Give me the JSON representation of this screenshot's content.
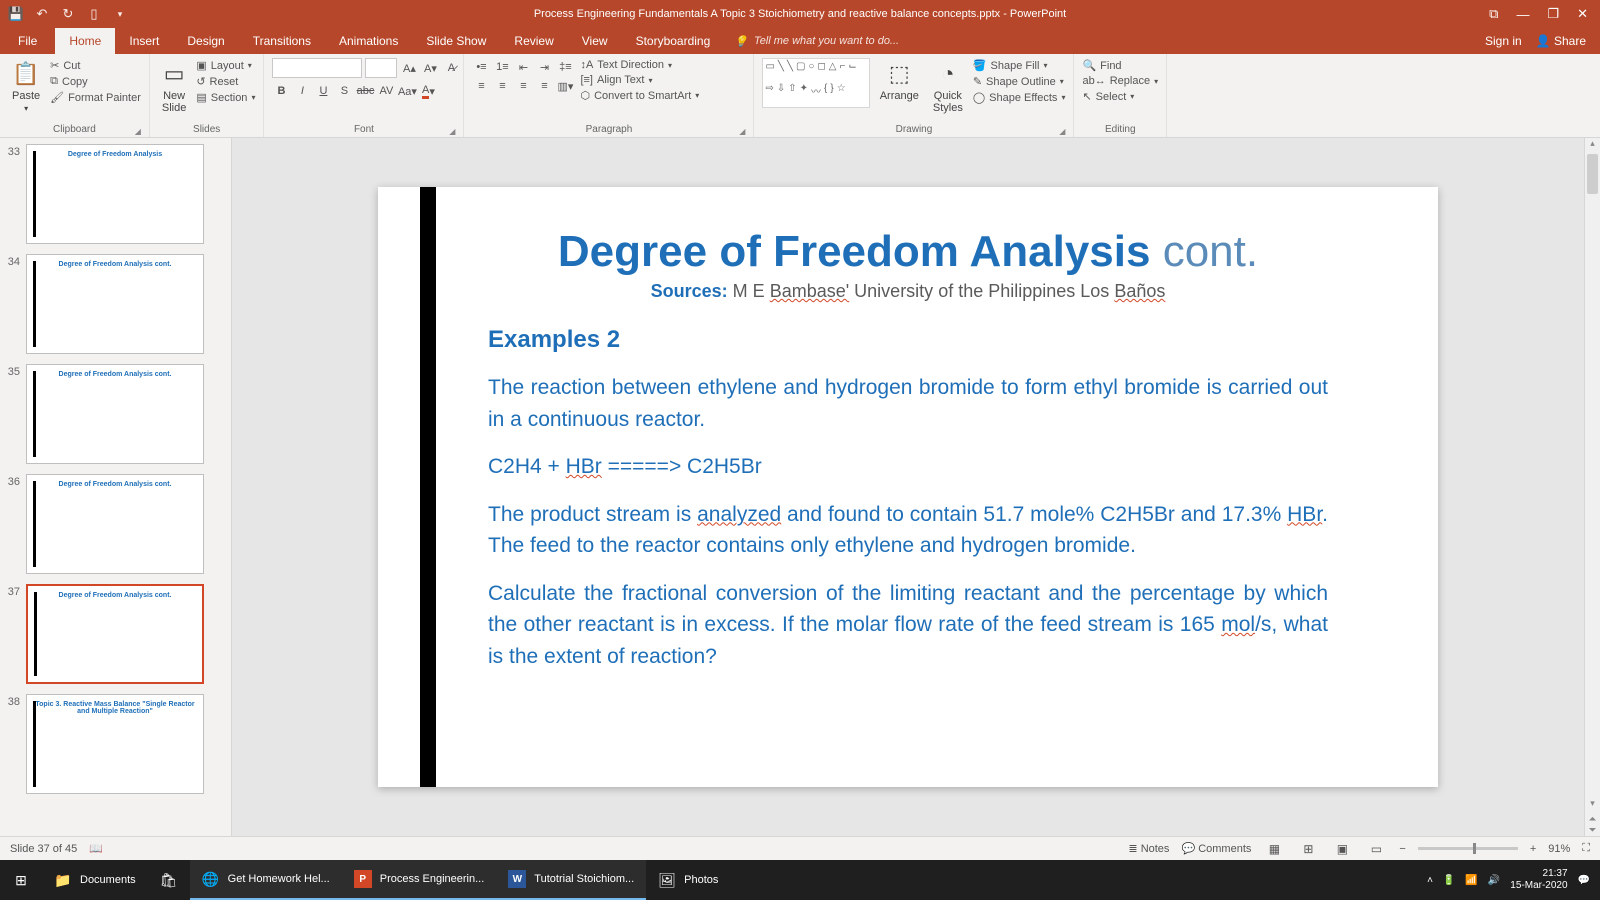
{
  "titlebar": {
    "title": "Process Engineering Fundamentals A Topic 3 Stoichiometry and reactive balance concepts.pptx - PowerPoint"
  },
  "window_controls": {
    "display_settings": "⧉",
    "minimize": "—",
    "restore": "❐",
    "close": "✕"
  },
  "ribbon": {
    "tabs": {
      "file": "File",
      "home": "Home",
      "insert": "Insert",
      "design": "Design",
      "transitions": "Transitions",
      "animations": "Animations",
      "slideshow": "Slide Show",
      "review": "Review",
      "view": "View",
      "storyboarding": "Storyboarding"
    },
    "tell_me": "Tell me what you want to do...",
    "signin": "Sign in",
    "share": "Share",
    "groups": {
      "clipboard": {
        "label": "Clipboard",
        "paste": "Paste",
        "cut": "Cut",
        "copy": "Copy",
        "painter": "Format Painter"
      },
      "slides": {
        "label": "Slides",
        "new_slide": "New\nSlide",
        "layout": "Layout",
        "reset": "Reset",
        "section": "Section"
      },
      "font": {
        "label": "Font"
      },
      "paragraph": {
        "label": "Paragraph",
        "text_dir": "Text Direction",
        "align": "Align Text",
        "smartart": "Convert to SmartArt"
      },
      "drawing": {
        "label": "Drawing",
        "arrange": "Arrange",
        "quick": "Quick\nStyles",
        "fill": "Shape Fill",
        "outline": "Shape Outline",
        "effects": "Shape Effects"
      },
      "editing": {
        "label": "Editing",
        "find": "Find",
        "replace": "Replace",
        "select": "Select"
      }
    }
  },
  "thumbnails": [
    {
      "num": "33",
      "title": "Degree of Freedom Analysis"
    },
    {
      "num": "34",
      "title": "Degree of Freedom Analysis cont."
    },
    {
      "num": "35",
      "title": "Degree of Freedom Analysis cont."
    },
    {
      "num": "36",
      "title": "Degree of Freedom Analysis cont."
    },
    {
      "num": "37",
      "title": "Degree of Freedom Analysis cont."
    },
    {
      "num": "38",
      "title": "Topic 3. Reactive Mass Balance \"Single Reactor and Multiple Reaction\""
    }
  ],
  "active_thumb_index": 4,
  "slide": {
    "title_main": "Degree of Freedom Analysis",
    "title_cont": " cont.",
    "sources_label": "Sources:",
    "sources_text_1": " M E ",
    "sources_wavy_1": "Bambase'",
    "sources_text_2": " University of the Philippines Los ",
    "sources_wavy_2": "Baños",
    "heading": "Examples 2",
    "p1": "The reaction between ethylene and hydrogen bromide to form ethyl bromide is carried out in a continuous reactor.",
    "eq_1": "C2H4 + ",
    "eq_wavy": "HBr",
    "eq_2": " =====> C2H5Br",
    "p3a": "The product stream is ",
    "p3_wavy1": "analyzed",
    "p3b": " and found to contain 51.7 mole% C2H5Br and 17.3% ",
    "p3_wavy2": "HBr",
    "p3c": ". The feed to the reactor contains only ethylene and hydrogen bromide.",
    "p4a": "Calculate the fractional conversion of the limiting reactant and the percentage by which the other reactant is in excess. If the molar flow rate of the feed stream is 165 ",
    "p4_wavy": "mol",
    "p4b": "/s, what is the extent of reaction?"
  },
  "status": {
    "slide_count": "Slide 37 of 45",
    "notes": "Notes",
    "comments": "Comments",
    "zoom_pct": "91%"
  },
  "taskbar": {
    "items": {
      "documents": "Documents",
      "chrome": "Get Homework Hel...",
      "ppt": "Process Engineerin...",
      "word": "Tutotrial Stoichiom...",
      "photos": "Photos"
    },
    "time": "21:37",
    "date": "15-Mar-2020"
  }
}
